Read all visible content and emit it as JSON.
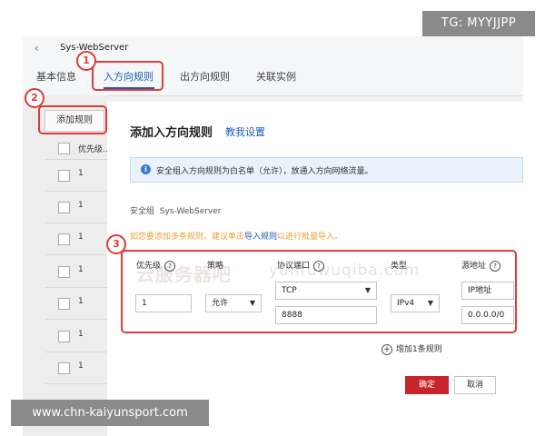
{
  "overlay": {
    "tg_badge": "TG: MYYJJPP",
    "footer_url": "www.chn-kaiyunsport.com",
    "watermark_cn": "云服务器吧",
    "watermark_en": "yunfuwuqiba.com"
  },
  "window": {
    "back_glyph": "‹",
    "title": "Sys-WebServer"
  },
  "tabs": [
    {
      "label": "基本信息"
    },
    {
      "label": "入方向规则"
    },
    {
      "label": "出方向规则"
    },
    {
      "label": "关联实例"
    }
  ],
  "annotations": [
    "1",
    "2",
    "3"
  ],
  "left_panel": {
    "add_rule_label": "添加规则",
    "priority_header": "优先级...",
    "rows": [
      "1",
      "1",
      "1",
      "1",
      "1",
      "1",
      "1"
    ]
  },
  "dialog": {
    "title": "添加入方向规则",
    "help_link": "教我设置",
    "info_icon": "i",
    "info_text": "安全组入方向规则为白名单（允许），放通入方向网络流量。",
    "security_group_label": "安全组",
    "security_group_value": "Sys-WebServer",
    "tip_prefix": "如您要添加多条规则，建议单击",
    "tip_link": "导入规则",
    "tip_suffix": "以进行批量导入。",
    "columns": {
      "priority": "优先级",
      "policy": "策略",
      "protocol_port": "协议端口",
      "type": "类型",
      "source": "源地址"
    },
    "help_glyph": "?",
    "rule": {
      "priority": "1",
      "policy": "允许",
      "protocol": "TCP",
      "port": "8888",
      "type": "IPv4",
      "source_type": "IP地址",
      "source_value": "0.0.0.0/0"
    },
    "add_more_icon": "+",
    "add_more": "增加1条规则",
    "ok": "确定",
    "cancel": "取消"
  },
  "colors": {
    "accent": "#1a5fb4",
    "annotation_red": "#e03a3a",
    "ok_red": "#c8242b",
    "tip_orange": "#e8a03a"
  }
}
